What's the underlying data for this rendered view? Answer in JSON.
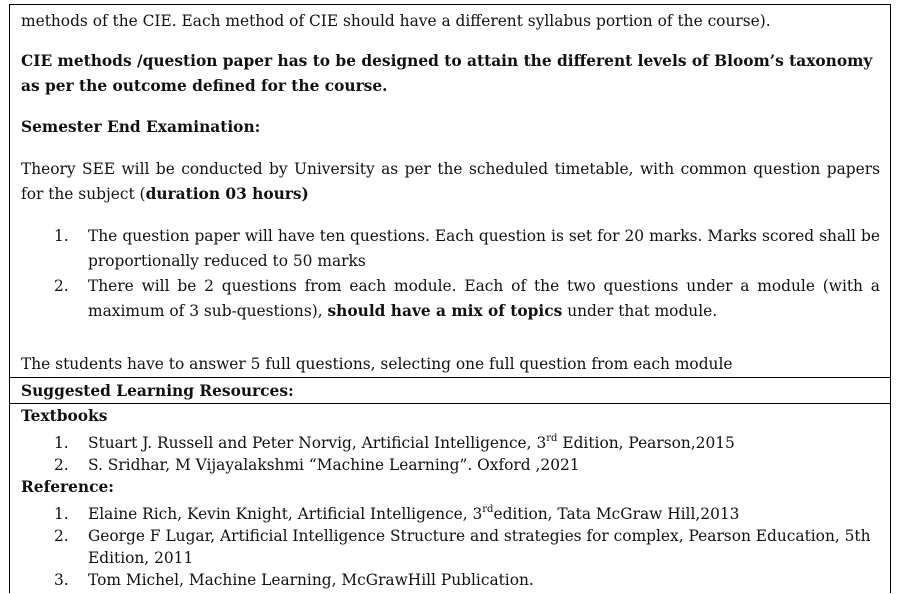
{
  "intro_line": "methods of the CIE.   Each method of CIE should have a different syllabus portion of the course).",
  "cie_note": "CIE methods /question paper has to be designed to attain the different levels of Bloom’s taxonomy as per the outcome defined for the course.",
  "see_heading": "Semester End Examination:",
  "see_text_plain": "Theory SEE will be conducted by University as per the scheduled timetable, with common question papers for the subject (",
  "see_text_bold": "duration 03 hours)",
  "see_list": [
    {
      "num": "1.",
      "text": "The question paper will have ten questions. Each question is set for 20 marks. Marks scored shall be proportionally reduced to 50 marks"
    },
    {
      "num": "2.",
      "text_before": "There will be 2 questions from each module. Each of the two questions under a module (with a maximum of 3 sub-questions), ",
      "text_bold": "should have a mix of topics",
      "text_after": " under that module."
    }
  ],
  "students_note": "The students have to answer 5 full questions, selecting one full question from each module",
  "resources_heading": "Suggested Learning Resources:",
  "textbooks_heading": "Textbooks",
  "textbooks": [
    {
      "num": "1.",
      "before": "Stuart J. Russell and Peter Norvig, Artificial Intelligence, 3",
      "sup": "rd",
      "after": " Edition, Pearson,2015"
    },
    {
      "num": "2.",
      "text": "S. Sridhar, M Vijayalakshmi “Machine Learning”. Oxford ,2021"
    }
  ],
  "reference_heading": "Reference:",
  "references": [
    {
      "num": "1.",
      "before": "Elaine Rich, Kevin Knight, Artificial Intelligence, 3",
      "sup": "rd",
      "after": "edition, Tata McGraw Hill,2013"
    },
    {
      "num": "2.",
      "text": "George F Lugar, Artificial Intelligence Structure and strategies for complex, Pearson Education, 5th Edition, 2011"
    },
    {
      "num": "3.",
      "text": "Tom Michel, Machine Learning,  McGrawHill Publication."
    }
  ]
}
